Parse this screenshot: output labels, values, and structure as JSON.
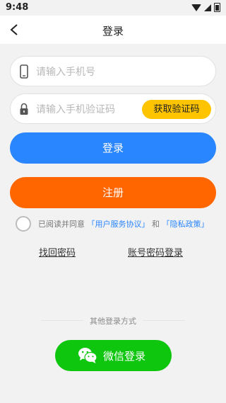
{
  "status_bar": {
    "time": "9:48"
  },
  "nav": {
    "title": "登录"
  },
  "phone_field": {
    "placeholder": "请输入手机号"
  },
  "code_field": {
    "placeholder": "请输入手机验证码",
    "get_code_label": "获取验证码"
  },
  "buttons": {
    "login": "登录",
    "register": "注册"
  },
  "agreement": {
    "prefix": "已阅读并同意",
    "user_agreement": "「用户服务协议」",
    "and": "和",
    "privacy_policy": "「隐私政策」"
  },
  "links": {
    "recover_password": "找回密码",
    "account_login": "账号密码登录"
  },
  "other_login": {
    "label": "其他登录方式",
    "wechat": "微信登录"
  },
  "colors": {
    "primary": "#2a86ff",
    "register": "#ff6600",
    "code_button": "#ffc400",
    "wechat": "#0ec60e",
    "background": "#f2f2f2"
  }
}
